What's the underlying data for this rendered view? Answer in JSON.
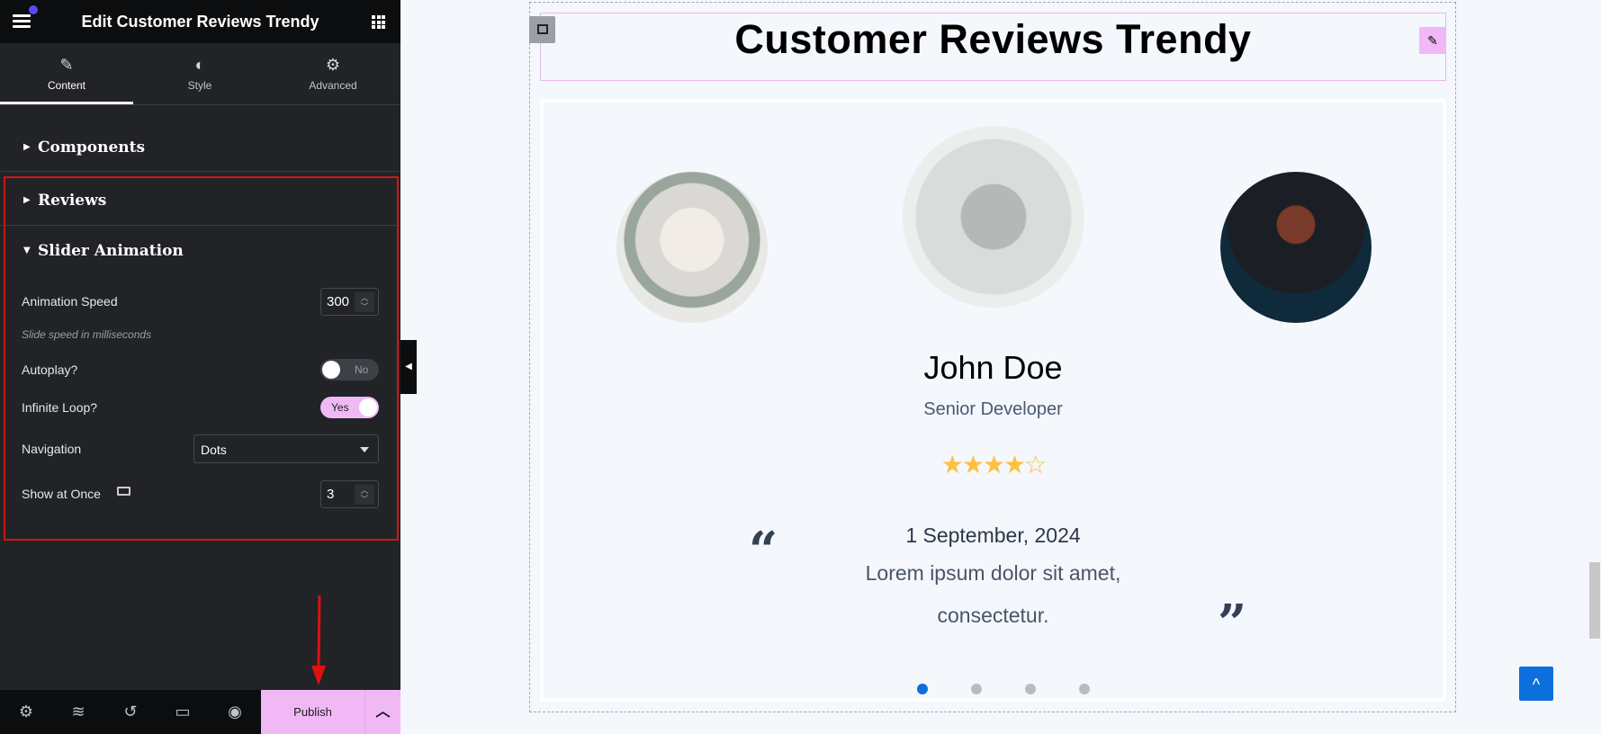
{
  "editor": {
    "title": "Edit Customer Reviews Trendy",
    "tabs": [
      {
        "label": "Content",
        "icon": "pencil-icon",
        "active": true
      },
      {
        "label": "Style",
        "icon": "half-circle-icon"
      },
      {
        "label": "Advanced",
        "icon": "gear-icon"
      }
    ],
    "sections": {
      "components": "Components",
      "reviews": "Reviews",
      "slider_animation": "Slider Animation"
    },
    "controls": {
      "animation_speed_label": "Animation Speed",
      "animation_speed_value": "300",
      "animation_speed_help": "Slide speed in milliseconds",
      "autoplay_label": "Autoplay?",
      "autoplay_value": "No",
      "infinite_loop_label": "Infinite Loop?",
      "infinite_loop_value": "Yes",
      "navigation_label": "Navigation",
      "navigation_value": "Dots",
      "show_at_once_label": "Show at Once",
      "show_at_once_value": "3"
    },
    "footer": {
      "publish_label": "Publish"
    },
    "accent_color": "#f0b9f6"
  },
  "canvas": {
    "heading": "Customer Reviews Trendy",
    "review": {
      "name": "John Doe",
      "role": "Senior Developer",
      "rating": 4,
      "max_rating": 5,
      "date": "1 September, 2024",
      "text_line1": "Lorem ipsum dolor sit amet,",
      "text_line2": "consectetur."
    },
    "dots": {
      "count": 4,
      "active": 1
    },
    "star_color": "#fdc040",
    "dot_active_color": "#0d6fdb"
  }
}
